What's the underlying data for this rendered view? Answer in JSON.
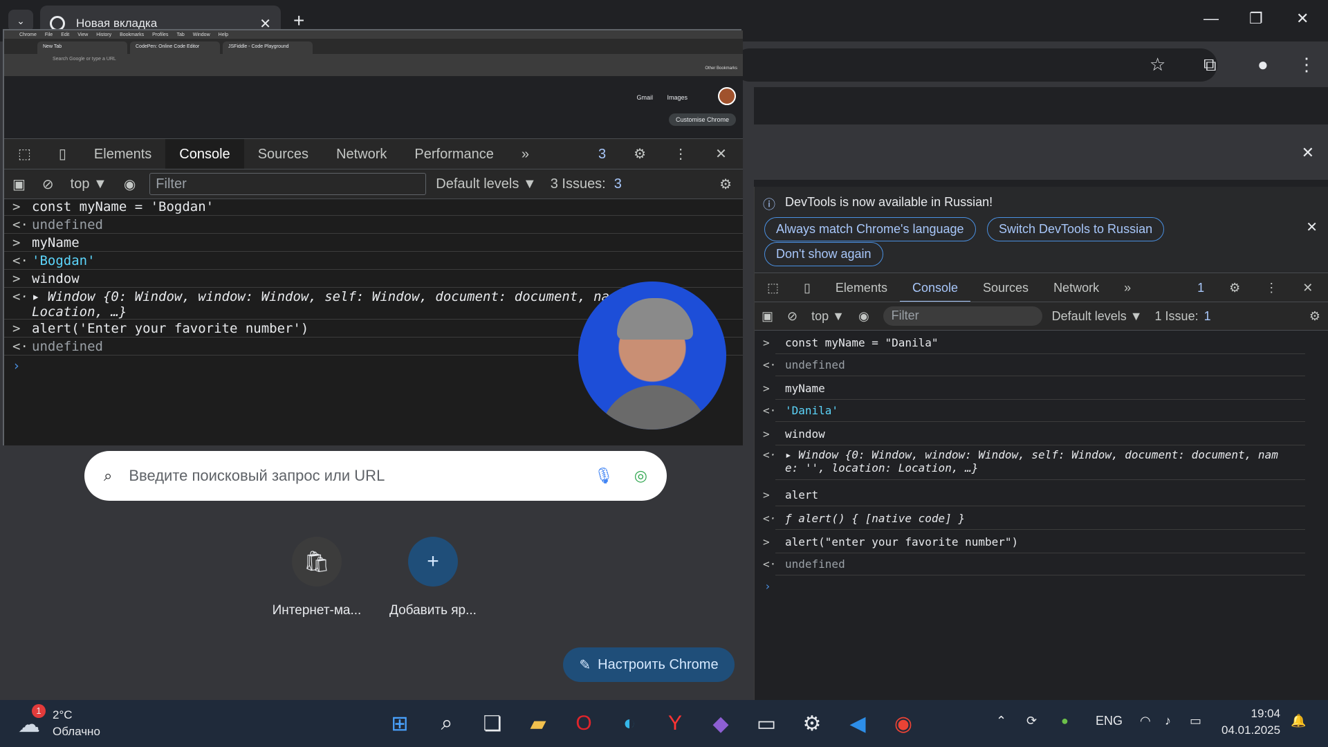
{
  "browser": {
    "tab_title": "Новая вкладка",
    "new_tab": "+",
    "minimize": "—",
    "restore": "❐",
    "close": "✕"
  },
  "embedded": {
    "menubar": [
      "Chrome",
      "File",
      "Edit",
      "View",
      "History",
      "Bookmarks",
      "Profiles",
      "Tab",
      "Window",
      "Help"
    ],
    "tabs": [
      "New Tab",
      "CodePen: Online Code Editor",
      "JSFiddle - Code Playground"
    ],
    "address": "Search Google or type a URL",
    "bookmarks": "Other Bookmarks",
    "gmail": "Gmail",
    "images": "Images",
    "customise": "Customise Chrome",
    "devtools": {
      "tabs": [
        "Elements",
        "Console",
        "Sources",
        "Network",
        "Performance"
      ],
      "issues_badge": "3",
      "context": "top ▼",
      "filter_placeholder": "Filter",
      "levels": "Default levels ▼",
      "issues_label": "3 Issues:",
      "issues_count": "3",
      "lines": [
        {
          "arrow": ">",
          "code": "const myName = 'Bogdan'"
        },
        {
          "arrow": "<·",
          "code": "undefined"
        },
        {
          "arrow": ">",
          "code": "myName"
        },
        {
          "arrow": "<·",
          "code": "'Bogdan'"
        },
        {
          "arrow": ">",
          "code": "window"
        },
        {
          "arrow": "<·",
          "code": "▸ Window {0: Window, window: Window, self: Window, document: document, na"
        },
        {
          "arrow": "",
          "code": "Location, …}"
        },
        {
          "arrow": ">",
          "code": "alert('Enter your favorite number')"
        },
        {
          "arrow": "<·",
          "code": "undefined"
        }
      ]
    }
  },
  "ntp": {
    "search_placeholder": "Введите поисковый запрос или URL",
    "shortcuts": [
      {
        "label": "Интернет-ма..."
      },
      {
        "label": "Добавить яр..."
      }
    ],
    "customize": "Настроить Chrome"
  },
  "right_devtools": {
    "banner_text": "DevTools is now available in Russian!",
    "btn_match": "Always match Chrome's language",
    "btn_switch": "Switch DevTools to Russian",
    "btn_dont": "Don't show again",
    "tabs": [
      "Elements",
      "Console",
      "Sources",
      "Network"
    ],
    "issues_badge": "1",
    "context": "top ▼",
    "filter_placeholder": "Filter",
    "levels": "Default levels ▼",
    "issues_label": "1 Issue:",
    "issues_count": "1",
    "lines": [
      {
        "arrow": ">",
        "code": "const myName = \"Danila\""
      },
      {
        "arrow": "<·",
        "code": "undefined"
      },
      {
        "arrow": ">",
        "code": "myName"
      },
      {
        "arrow": "<·",
        "code": "'Danila'"
      },
      {
        "arrow": ">",
        "code": "window"
      },
      {
        "arrow": "<·",
        "code": "▸ Window {0: Window, window: Window, self: Window, document: document, nam"
      },
      {
        "arrow": "",
        "code": "e: '', location: Location, …}"
      },
      {
        "arrow": ">",
        "code": "alert"
      },
      {
        "arrow": "<·",
        "code": "ƒ alert() { [native code] }"
      },
      {
        "arrow": ">",
        "code": "alert(\"enter your favorite number\")"
      },
      {
        "arrow": "<·",
        "code": "undefined"
      }
    ]
  },
  "taskbar": {
    "weather_temp": "2°C",
    "weather_desc": "Облачно",
    "weather_badge": "1",
    "lang": "ENG",
    "time": "19:04",
    "date": "04.01.2025"
  }
}
